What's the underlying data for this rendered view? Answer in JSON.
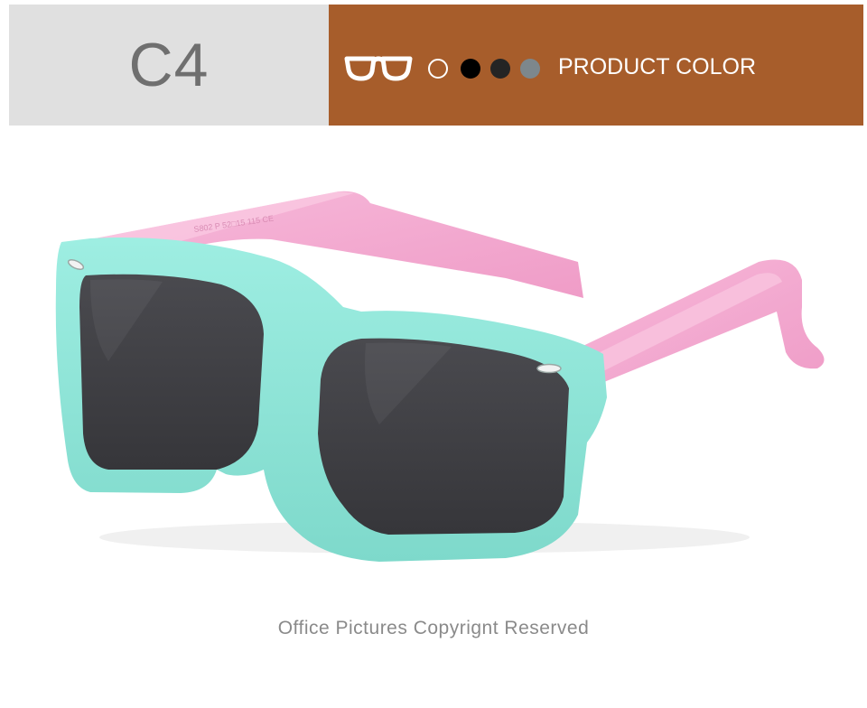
{
  "header": {
    "variant_code": "C4",
    "product_color_label": "PRODUCT COLOR",
    "glasses_icon": "eyeglasses-outline-icon",
    "swatches": [
      {
        "name": "outline-swatch",
        "color": "#ffffff"
      },
      {
        "name": "black-swatch",
        "color": "#000000"
      },
      {
        "name": "dark-gray-swatch",
        "color": "#242424"
      },
      {
        "name": "gray-swatch",
        "color": "#7d878c"
      }
    ],
    "colors": {
      "left_panel": "#e0e0e0",
      "right_panel": "#a75d2b",
      "code_text": "#6f6f6f"
    }
  },
  "product": {
    "temple_imprint": "S802 P 52□15 115 CE",
    "colors": {
      "frame": "#8ee6d8",
      "temples": "#f3a9cf",
      "lenses": "#3f3f43"
    }
  },
  "footer": {
    "copyright": "Office Pictures Copyrignt Reserved"
  }
}
